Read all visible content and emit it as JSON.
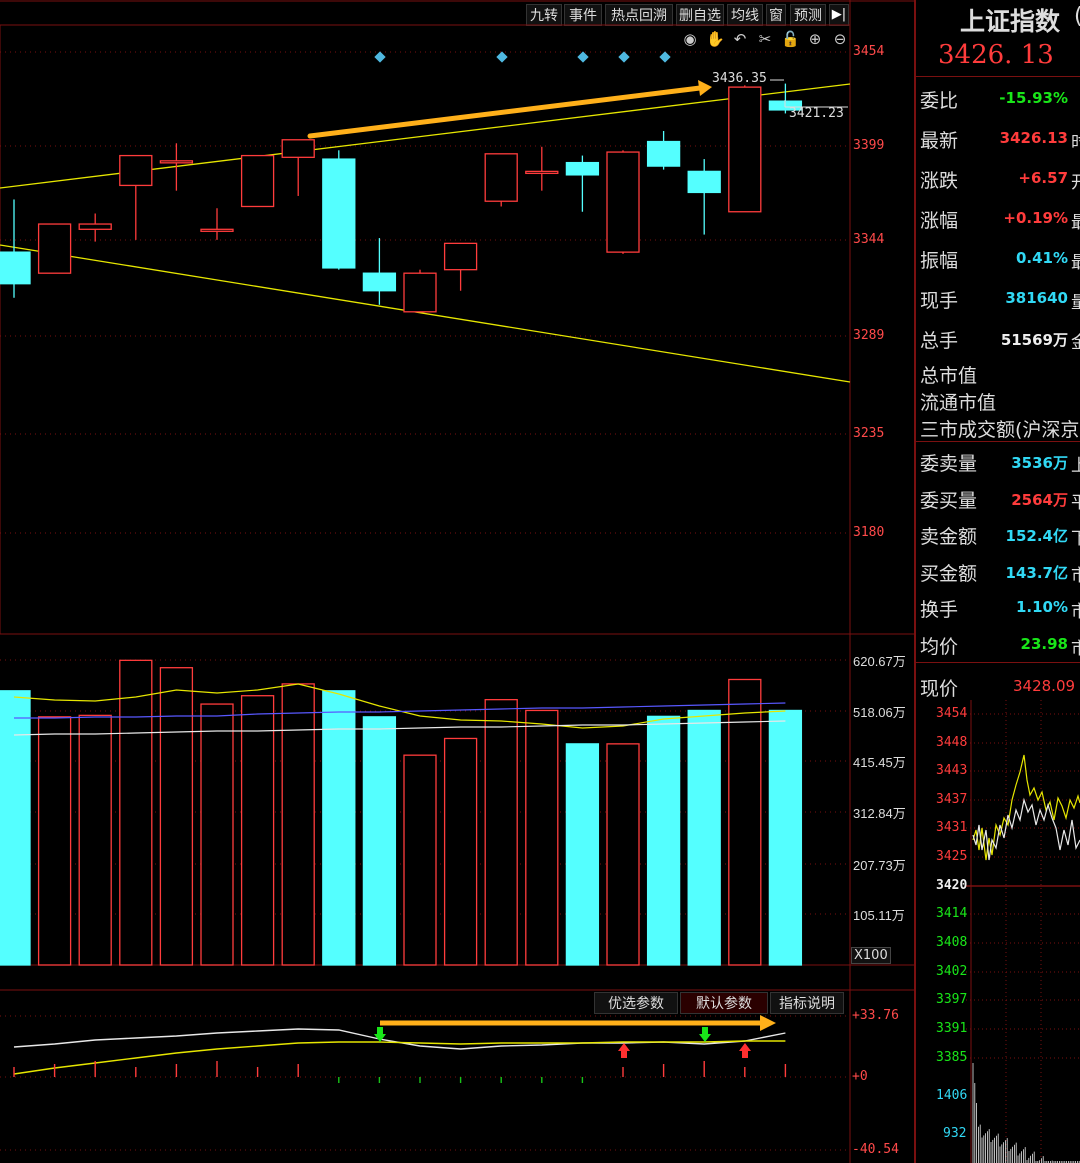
{
  "toolbar": {
    "buttons": [
      "九转",
      "事件",
      "热点回溯",
      "删自选",
      "均线",
      "窗",
      "预测"
    ],
    "collapse_icon": "collapse-panel-icon"
  },
  "tools": [
    "eye-icon",
    "hand-icon",
    "undo-icon",
    "scissors-icon",
    "lock-icon",
    "zoom-in-icon",
    "zoom-out-icon"
  ],
  "price_axis": {
    "labels": [
      "3454",
      "3399",
      "3344",
      "3289",
      "3235",
      "3180"
    ]
  },
  "annotations": {
    "high_label": "3436.35",
    "last_label": "3421.23"
  },
  "volume_axis": {
    "labels": [
      "620.67万",
      "518.06万",
      "415.45万",
      "312.84万",
      "207.73万",
      "105.11万"
    ],
    "unit": "X100"
  },
  "indicator": {
    "buttons": [
      "优选参数",
      "默认参数",
      "指标说明"
    ],
    "labels": [
      "+33.76",
      "+0",
      "-40.54"
    ]
  },
  "quote": {
    "name": "上证指数",
    "price": "3426. 13",
    "rows": [
      {
        "label": "委比",
        "value": "-15.93%",
        "color": "green"
      },
      {
        "label": "最新",
        "value": "3426.13",
        "color": "red",
        "cut": "时"
      },
      {
        "label": "涨跌",
        "value": "+6.57",
        "color": "red",
        "cut": "开"
      },
      {
        "label": "涨幅",
        "value": "+0.19%",
        "color": "red",
        "cut": "最"
      },
      {
        "label": "振幅",
        "value": "0.41%",
        "color": "cyan",
        "cut": "最"
      },
      {
        "label": "现手",
        "value": "381640",
        "color": "cyan",
        "cut": "量"
      },
      {
        "label": "总手",
        "value": "51569万",
        "color": "white",
        "cut": "金"
      }
    ],
    "market_cap": "总市值",
    "float_cap": "流通市值",
    "turnover_3": "三市成交额(沪深京",
    "rows2": [
      {
        "label": "委卖量",
        "value": "3536万",
        "color": "cyan",
        "cut": "上"
      },
      {
        "label": "委买量",
        "value": "2564万",
        "color": "red",
        "cut": "平"
      },
      {
        "label": "卖金额",
        "value": "152.4亿",
        "color": "cyan",
        "cut": "下"
      },
      {
        "label": "买金额",
        "value": "143.7亿",
        "color": "cyan",
        "cut": "市"
      },
      {
        "label": "换手",
        "value": "1.10%",
        "color": "cyan",
        "cut": "市"
      },
      {
        "label": "均价",
        "value": "23.98",
        "color": "green",
        "cut": "市"
      }
    ],
    "current_label": "现价",
    "current_value": "3428.09"
  },
  "minichart": {
    "price_labels": [
      "3454",
      "3448",
      "3443",
      "3437",
      "3431",
      "3425",
      "3420",
      "3414",
      "3408",
      "3402",
      "3397",
      "3391",
      "3385"
    ],
    "vol_labels": [
      "1406",
      "932"
    ]
  },
  "colors": {
    "up": "#ff3c3c",
    "down": "#54ffff",
    "trend": "#e6e600",
    "arrow": "#ffb01a",
    "grid": "#7a1010"
  },
  "chart_data": {
    "type": "candlestick",
    "ylim": [
      3180,
      3454
    ],
    "candles": [
      {
        "o": 3340,
        "h": 3370,
        "l": 3314,
        "c": 3322
      },
      {
        "o": 3328,
        "h": 3356,
        "l": 3328,
        "c": 3356
      },
      {
        "o": 3353,
        "h": 3362,
        "l": 3346,
        "c": 3356
      },
      {
        "o": 3378,
        "h": 3383,
        "l": 3347,
        "c": 3395
      },
      {
        "o": 3392,
        "h": 3402,
        "l": 3375,
        "c": 3392
      },
      {
        "o": 3353,
        "h": 3365,
        "l": 3347,
        "c": 3353
      },
      {
        "o": 3366,
        "h": 3395,
        "l": 3366,
        "c": 3395
      },
      {
        "o": 3394,
        "h": 3404,
        "l": 3372,
        "c": 3404
      },
      {
        "o": 3393,
        "h": 3398,
        "l": 3330,
        "c": 3331
      },
      {
        "o": 3328,
        "h": 3348,
        "l": 3310,
        "c": 3318
      },
      {
        "o": 3306,
        "h": 3330,
        "l": 3306,
        "c": 3328
      },
      {
        "o": 3330,
        "h": 3345,
        "l": 3318,
        "c": 3345
      },
      {
        "o": 3369,
        "h": 3392,
        "l": 3366,
        "c": 3396
      },
      {
        "o": 3385,
        "h": 3400,
        "l": 3375,
        "c": 3386
      },
      {
        "o": 3391,
        "h": 3395,
        "l": 3363,
        "c": 3384
      },
      {
        "o": 3340,
        "h": 3398,
        "l": 3339,
        "c": 3397
      },
      {
        "o": 3403,
        "h": 3409,
        "l": 3387,
        "c": 3389
      },
      {
        "o": 3386,
        "h": 3393,
        "l": 3350,
        "c": 3374
      },
      {
        "o": 3363,
        "h": 3435,
        "l": 3363,
        "c": 3434
      },
      {
        "o": 3426,
        "h": 3436,
        "l": 3419,
        "c": 3421
      }
    ],
    "volume": [
      558,
      505,
      508,
      620,
      605,
      531,
      548,
      572,
      558,
      505,
      427,
      461,
      540,
      518,
      450,
      450,
      506,
      518,
      581,
      518
    ]
  }
}
